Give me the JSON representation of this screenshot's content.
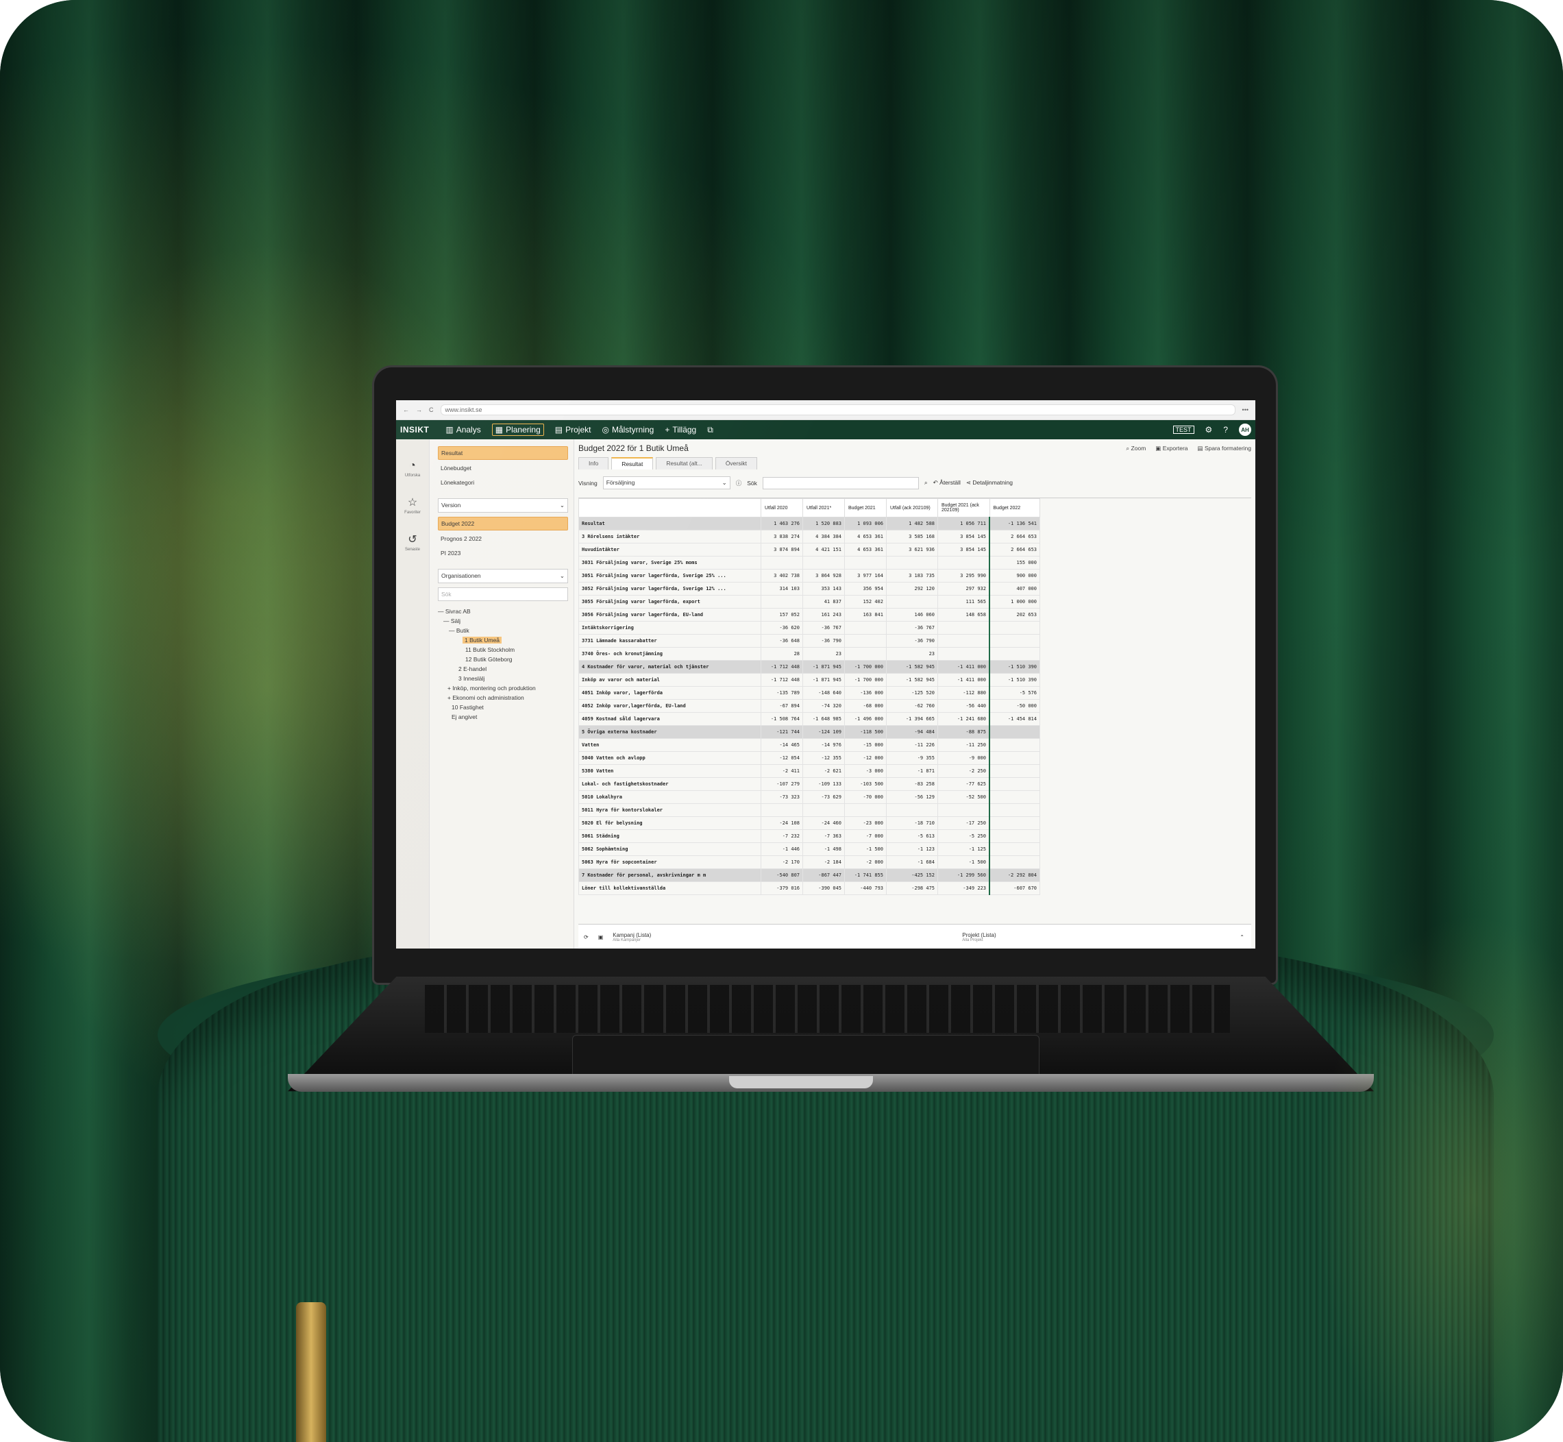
{
  "browser": {
    "url": "www.insikt.se",
    "menu": "•••"
  },
  "appbar": {
    "logo": "INSIKT",
    "nav": [
      "Analys",
      "Planering",
      "Projekt",
      "Målstyrning",
      "Tillägg"
    ],
    "test_badge": "TEST",
    "avatar": "AH"
  },
  "rail": [
    "Utforska",
    "Favoriter",
    "Senaste"
  ],
  "sidebar": {
    "views": [
      "Resultat",
      "Lönebudget",
      "Lönekategori"
    ],
    "version_label": "Version",
    "versions": [
      "Budget 2022",
      "Prognos 2 2022",
      "PI 2023"
    ],
    "org_label": "Organisationen",
    "search_placeholder": "Sök",
    "tree": [
      "— Sivrac AB",
      "— Sälj",
      "— Butik",
      "1 Butik Umeå",
      "11 Butik Stockholm",
      "12 Butik Göteborg",
      "2 E-handel",
      "3 Inneslälj",
      "+ Inköp, montering och produktion",
      "+ Ekonomi och administration",
      "10 Fastighet",
      "Ej angivet"
    ]
  },
  "main": {
    "title": "Budget 2022 för 1 Butik Umeå",
    "tools": [
      "Zoom",
      "Exportera",
      "Spara formatering"
    ],
    "tabs": [
      "Info",
      "Resultat",
      "Resultat (alt...",
      "Översikt"
    ],
    "visning_label": "Visning",
    "visning_value": "Försäljning",
    "sok_label": "Sök",
    "aterstall": "Återställ",
    "detalj": "Detaljinmatning",
    "columns": [
      "Utfall 2020",
      "Utfall 2021*",
      "Budget 2021",
      "Utfall (ack 202109)",
      "Budget 2021 (ack 202109)",
      "Budget 2022"
    ],
    "rows": [
      {
        "name": "Resultat",
        "sum": true,
        "v": [
          "1 463 276",
          "1 520 883",
          "1 093 006",
          "1 482 588",
          "1 056 711",
          "-1 136 541"
        ]
      },
      {
        "name": "3 Rörelsens intäkter",
        "sum": false,
        "v": [
          "3 838 274",
          "4 384 384",
          "4 653 361",
          "3 585 168",
          "3 854 145",
          "2 664 653"
        ]
      },
      {
        "name": "Huvudintäkter",
        "sum": false,
        "v": [
          "3 874 894",
          "4 421 151",
          "4 653 361",
          "3 621 936",
          "3 854 145",
          "2 664 653"
        ]
      },
      {
        "name": "3031 Försäljning varor, Sverige 25% moms",
        "sum": false,
        "v": [
          "",
          "",
          "",
          "",
          "",
          "155 000"
        ]
      },
      {
        "name": "3051 Försäljning varor lagerförda, Sverige 25% ...",
        "sum": false,
        "v": [
          "3 402 738",
          "3 864 928",
          "3 977 164",
          "3 183 735",
          "3 295 990",
          "900 000"
        ]
      },
      {
        "name": "3052 Försäljning varor lagerförda, Sverige 12% ...",
        "sum": false,
        "v": [
          "314 103",
          "353 143",
          "356 954",
          "292 120",
          "297 932",
          "407 000"
        ]
      },
      {
        "name": "3055 Försäljning varor lagerförda, export",
        "sum": false,
        "v": [
          "",
          "41 837",
          "152 402",
          "",
          "111 565",
          "1 000 000"
        ]
      },
      {
        "name": "3056 Försäljning varor lagerförda, EU-land",
        "sum": false,
        "v": [
          "157 052",
          "161 243",
          "163 841",
          "146 060",
          "148 658",
          "202 653"
        ]
      },
      {
        "name": "Intäktskorrigering",
        "sum": false,
        "v": [
          "-36 620",
          "-36 767",
          "",
          "-36 767",
          "",
          ""
        ]
      },
      {
        "name": "3731 Lämnade kassarabatter",
        "sum": false,
        "v": [
          "-36 648",
          "-36 790",
          "",
          "-36 790",
          "",
          ""
        ]
      },
      {
        "name": "3740 Öres- och kronutjämning",
        "sum": false,
        "v": [
          "28",
          "23",
          "",
          "23",
          "",
          ""
        ]
      },
      {
        "name": "4 Kostnader för varor, material och tjänster",
        "sum": true,
        "v": [
          "-1 712 448",
          "-1 871 945",
          "-1 700 000",
          "-1 582 945",
          "-1 411 000",
          "-1 510 390"
        ]
      },
      {
        "name": "Inköp av varor och material",
        "sum": false,
        "v": [
          "-1 712 448",
          "-1 871 945",
          "-1 700 000",
          "-1 582 945",
          "-1 411 000",
          "-1 510 390"
        ]
      },
      {
        "name": "4051 Inköp varor, lagerförda",
        "sum": false,
        "v": [
          "-135 789",
          "-148 640",
          "-136 000",
          "-125 520",
          "-112 880",
          "-5 576"
        ]
      },
      {
        "name": "4052 Inköp varor,lagerförda, EU-land",
        "sum": false,
        "v": [
          "-67 894",
          "-74 320",
          "-68 000",
          "-62 760",
          "-56 440",
          "-50 000"
        ]
      },
      {
        "name": "4059 Kostnad såld lagervara",
        "sum": false,
        "v": [
          "-1 508 764",
          "-1 648 985",
          "-1 496 000",
          "-1 394 665",
          "-1 241 680",
          "-1 454 814"
        ]
      },
      {
        "name": "5 Övriga externa kostnader",
        "sum": true,
        "v": [
          "-121 744",
          "-124 109",
          "-118 500",
          "-94 484",
          "-88 875",
          ""
        ]
      },
      {
        "name": "Vatten",
        "sum": false,
        "v": [
          "-14 465",
          "-14 976",
          "-15 000",
          "-11 226",
          "-11 250",
          ""
        ]
      },
      {
        "name": "5040 Vatten och avlopp",
        "sum": false,
        "v": [
          "-12 054",
          "-12 355",
          "-12 000",
          "-9 355",
          "-9 000",
          ""
        ]
      },
      {
        "name": "5380 Vatten",
        "sum": false,
        "v": [
          "-2 411",
          "-2 621",
          "-3 000",
          "-1 871",
          "-2 250",
          ""
        ]
      },
      {
        "name": "Lokal- och fastighetskostnader",
        "sum": false,
        "v": [
          "-107 279",
          "-109 133",
          "-103 500",
          "-83 258",
          "-77 625",
          ""
        ]
      },
      {
        "name": "5010 Lokalhyra",
        "sum": false,
        "v": [
          "-73 323",
          "-73 629",
          "-70 000",
          "-56 129",
          "-52 500",
          ""
        ]
      },
      {
        "name": "5011 Hyra för kontorslokaler",
        "sum": false,
        "v": [
          "",
          "",
          "",
          "",
          "",
          ""
        ]
      },
      {
        "name": "5020 El för belysning",
        "sum": false,
        "v": [
          "-24 108",
          "-24 460",
          "-23 000",
          "-18 710",
          "-17 250",
          ""
        ]
      },
      {
        "name": "5061 Städning",
        "sum": false,
        "v": [
          "-7 232",
          "-7 363",
          "-7 000",
          "-5 613",
          "-5 250",
          ""
        ]
      },
      {
        "name": "5062 Sophämtning",
        "sum": false,
        "v": [
          "-1 446",
          "-1 498",
          "-1 500",
          "-1 123",
          "-1 125",
          ""
        ]
      },
      {
        "name": "5063 Hyra för sopcontainer",
        "sum": false,
        "v": [
          "-2 170",
          "-2 184",
          "-2 000",
          "-1 684",
          "-1 500",
          ""
        ]
      },
      {
        "name": "7 Kostnader för personal, avskrivningar m m",
        "sum": true,
        "v": [
          "-540 807",
          "-867 447",
          "-1 741 855",
          "-425 152",
          "-1 299 560",
          "-2 292 804"
        ]
      },
      {
        "name": "Löner till kollektivanställda",
        "sum": false,
        "v": [
          "-379 016",
          "-390 045",
          "-440 793",
          "-298 475",
          "-349 223",
          "-607 670"
        ]
      }
    ]
  },
  "bottom": {
    "kampanj": "Kampanj (Lista)",
    "kampanj_sub": "Alla Kampanjer",
    "projekt": "Projekt (Lista)",
    "projekt_sub": "Alla Projekt"
  },
  "colors": {
    "appbar": "#143d2b",
    "accent": "#f0b44a",
    "comment": "#1f6b47"
  }
}
